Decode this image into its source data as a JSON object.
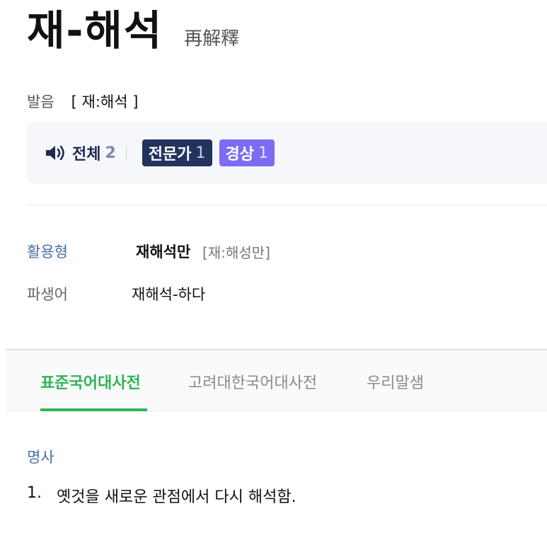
{
  "headword": "재-해석",
  "hanja": "再解釋",
  "pronunciation": {
    "label": "발음",
    "value": "[ 재:해석 ]"
  },
  "audio": {
    "speaker_icon": "speaker-icon",
    "all_label": "전체",
    "all_count": "2",
    "badges": [
      {
        "label": "전문가",
        "count": "1",
        "color": "#22335e"
      },
      {
        "label": "경상",
        "count": "1",
        "color": "#7b6cf3"
      }
    ]
  },
  "inflection": {
    "label": "활용형",
    "word": "재해석만",
    "pron": "[재:해성만]"
  },
  "derivative": {
    "label": "파생어",
    "word": "재해석-하다"
  },
  "tabs": [
    {
      "label": "표준국어대사전",
      "active": true
    },
    {
      "label": "고려대한국어대사전",
      "active": false
    },
    {
      "label": "우리말샘",
      "active": false
    }
  ],
  "definition": {
    "pos": "명사",
    "number": "1.",
    "text": "옛것을 새로운 관점에서 다시 해석함."
  },
  "colors": {
    "accent_green": "#2fb455",
    "label_blue": "#4a6fa5"
  }
}
